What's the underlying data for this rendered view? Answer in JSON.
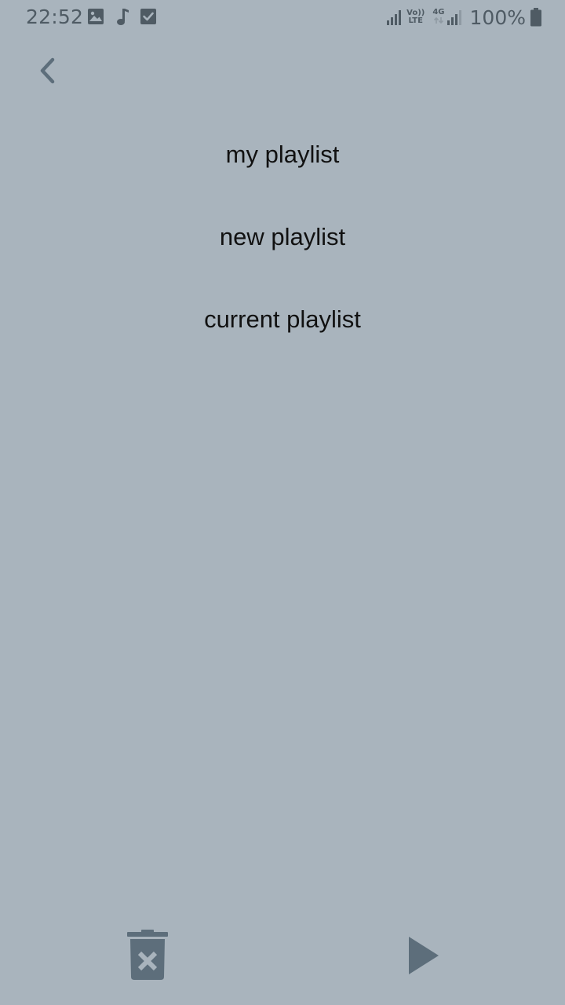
{
  "status_bar": {
    "time": "22:52",
    "battery": "100%",
    "volte_label_top": "Vo))",
    "volte_label_bottom": "LTE",
    "network_label": "4G"
  },
  "playlists": [
    {
      "label": "my playlist"
    },
    {
      "label": "new playlist"
    },
    {
      "label": "current playlist"
    }
  ],
  "colors": {
    "background": "#a9b4bd",
    "icon": "#5d6e7b",
    "text": "#111111"
  },
  "icons": {
    "back": "chevron-left-icon",
    "delete": "trash-x-icon",
    "play": "play-icon"
  }
}
